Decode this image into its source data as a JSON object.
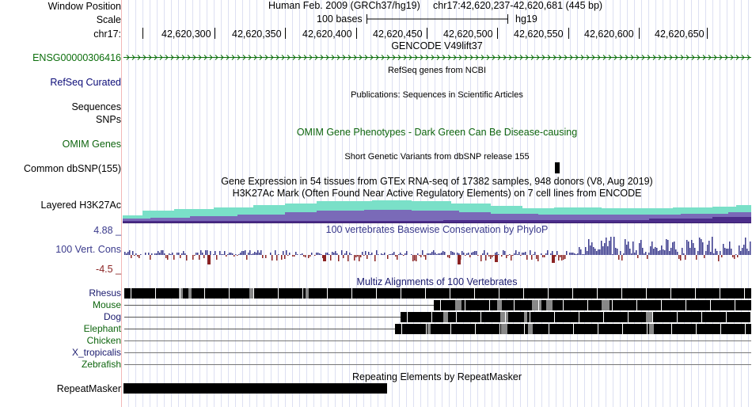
{
  "header": {
    "window_position_label": "Window Position",
    "scale_label": "Scale",
    "chrom_label": "chr17:",
    "assembly": "Human Feb. 2009 (GRCh37/hg19)",
    "position": "chr17:42,620,237-42,620,681 (445 bp)",
    "scale_text": "100 bases",
    "db_label": "hg19",
    "ticks": [
      "42,620,300",
      "42,620,350",
      "42,620,400",
      "42,620,450",
      "42,620,500",
      "42,620,550",
      "42,620,600",
      "42,620,650"
    ]
  },
  "tracks": {
    "gencode": {
      "title": "GENCODE V49lift37",
      "label": "ENSG00000306416"
    },
    "refseq": {
      "label": "RefSeq Curated",
      "title": "RefSeq genes from NCBI"
    },
    "publications": {
      "label": "Sequences",
      "title": "Publications: Sequences in Scientific Articles"
    },
    "snps": {
      "label": "SNPs"
    },
    "omim": {
      "label": "OMIM Genes",
      "title": "OMIM Gene Phenotypes - Dark Green Can Be Disease-causing"
    },
    "dbsnp": {
      "label": "Common dbSNP(155)",
      "title": "Short Genetic Variants from dbSNP release 155"
    },
    "gtex": {
      "title": "Gene Expression in 54 tissues from GTEx RNA-seq of 17382 samples, 948 donors (V8, Aug 2019)"
    },
    "h3k27ac": {
      "label": "Layered H3K27Ac",
      "title": "H3K27Ac Mark (Often Found Near Active Regulatory Elements) on 7 cell lines from ENCODE"
    },
    "cons": {
      "label": "100 Vert. Cons",
      "title": "100 vertebrates Basewise Conservation by PhyloP",
      "max_label": "4.88 _",
      "min_label": "-4.5 _"
    },
    "multiz": {
      "title": "Multiz Alignments of 100 Vertebrates",
      "species": [
        "Rhesus",
        "Mouse",
        "Dog",
        "Elephant",
        "Chicken",
        "X_tropicalis",
        "Zebrafish"
      ]
    },
    "repeatmasker": {
      "label": "RepeatMasker",
      "title": "Repeating Elements by RepeatMasker"
    }
  },
  "colors": {
    "gencode": "#0b6e0b",
    "refseq": "#0c0c78",
    "omim": "#0e650e",
    "cons_pos": "#3a3a8c",
    "cons_neg": "#8b2323",
    "multiz_title": "#1a1a6e",
    "h3k27ac_top": "#7ae0c8",
    "h3k27ac_mid": "#7a6ab8",
    "h3k27ac_base": "#4c2d8a"
  }
}
